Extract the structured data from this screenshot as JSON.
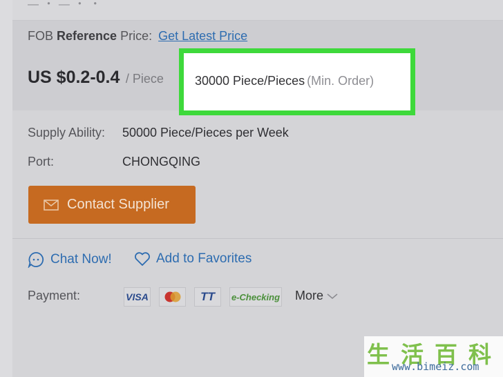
{
  "top": {
    "cut_text": "― ・ ― ・ ・"
  },
  "price_box": {
    "fob_prefix": "FOB ",
    "fob_bold": "Reference",
    "fob_suffix": " Price:",
    "fob_link": "Get Latest Price",
    "price_value": "US $0.2-0.4",
    "price_unit": "/ Piece"
  },
  "moq": {
    "text": "30000 Piece/Pieces",
    "note": "(Min. Order)",
    "highlight_color": "#3ed93b"
  },
  "info": {
    "supply_label": "Supply Ability:",
    "supply_value": "50000 Piece/Pieces per Week",
    "port_label": "Port:",
    "port_value": "CHONGQING"
  },
  "contact_button": {
    "label": "Contact Supplier",
    "color": "#c66a21",
    "icon": "mail-icon"
  },
  "actions": {
    "chat_label": "Chat Now!",
    "chat_icon": "chat-bubble-icon",
    "favorites_label": "Add to Favorites",
    "favorites_icon": "heart-icon"
  },
  "payment": {
    "label": "Payment:",
    "methods": [
      "VISA",
      "MasterCard",
      "TT",
      "e-Checking"
    ],
    "more_label": "More",
    "more_icon": "chevron-down-icon"
  },
  "watermark": {
    "chars": "生活百科",
    "url": "www.bimeiz.com"
  }
}
